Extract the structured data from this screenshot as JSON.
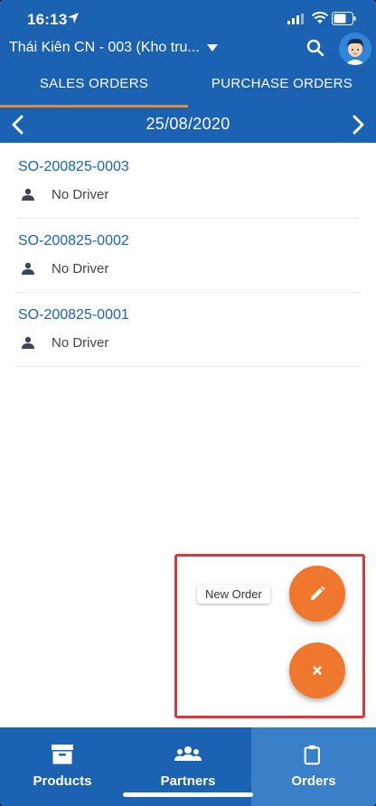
{
  "status_bar": {
    "time": "16:13"
  },
  "header": {
    "branch_title": "Thái Kiên CN - 003  (Kho tru..."
  },
  "tabs": [
    {
      "label": "SALES ORDERS",
      "active": true
    },
    {
      "label": "PURCHASE ORDERS",
      "active": false
    }
  ],
  "date_nav": {
    "date": "25/08/2020"
  },
  "orders": [
    {
      "order_no": "SO-200825-0003",
      "driver": "No Driver"
    },
    {
      "order_no": "SO-200825-0002",
      "driver": "No Driver"
    },
    {
      "order_no": "SO-200825-0001",
      "driver": "No Driver"
    }
  ],
  "fab": {
    "new_order_label": "New Order"
  },
  "bottom_nav": [
    {
      "label": "Products",
      "icon": "archive-box-icon"
    },
    {
      "label": "Partners",
      "icon": "people-group-icon"
    },
    {
      "label": "Orders",
      "icon": "clipboard-icon",
      "active": true
    }
  ],
  "colors": {
    "primary": "#1c62b3",
    "accent": "#f0782e",
    "tab_indicator": "#e08a3c",
    "highlight": "#e0353b"
  }
}
